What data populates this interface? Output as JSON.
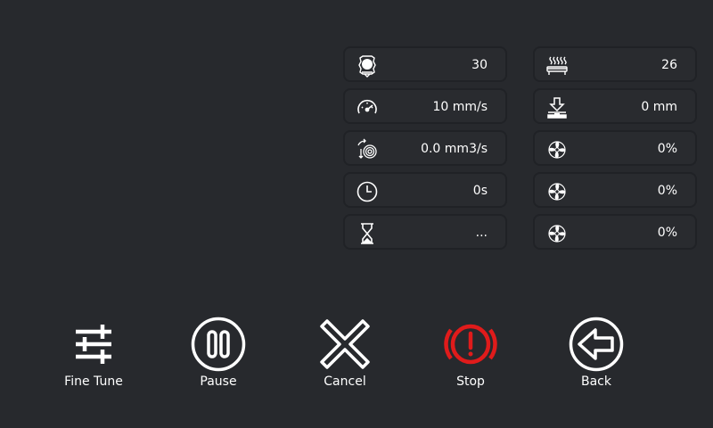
{
  "stats": {
    "left": [
      {
        "icon": "extruder-icon",
        "value": "30"
      },
      {
        "icon": "speedometer-icon",
        "value": "10 mm/s"
      },
      {
        "icon": "flow-icon",
        "value": "0.0 mm3/s"
      },
      {
        "icon": "clock-icon",
        "value": "0s"
      },
      {
        "icon": "hourglass-icon",
        "value": "..."
      }
    ],
    "right": [
      {
        "icon": "heated-bed-icon",
        "value": "26"
      },
      {
        "icon": "z-offset-icon",
        "value": "0 mm"
      },
      {
        "icon": "fan-icon",
        "value": "0%"
      },
      {
        "icon": "fan-icon",
        "value": "0%"
      },
      {
        "icon": "fan-icon",
        "value": "0%"
      }
    ]
  },
  "actions": {
    "fine_tune": "Fine Tune",
    "pause": "Pause",
    "cancel": "Cancel",
    "stop": "Stop",
    "back": "Back"
  },
  "colors": {
    "background": "#27292d",
    "card_border": "#202226",
    "text": "#ffffff",
    "stop_red": "#e01b1b"
  }
}
